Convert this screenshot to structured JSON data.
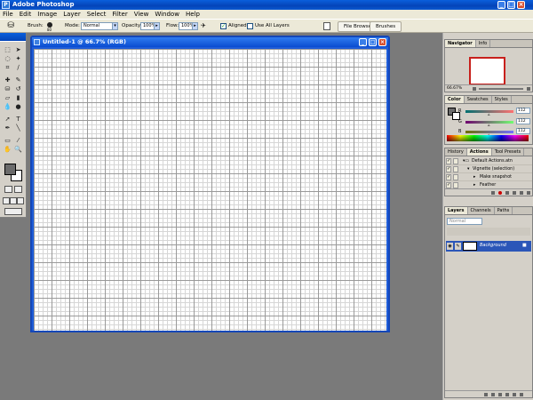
{
  "window": {
    "title": "Adobe Photoshop",
    "buttons": [
      "_",
      "□",
      "×"
    ]
  },
  "menu": [
    "File",
    "Edit",
    "Image",
    "Layer",
    "Select",
    "Filter",
    "View",
    "Window",
    "Help"
  ],
  "options_bar": {
    "brush_label": "Brush:",
    "brush_size": "80",
    "mode_label": "Mode:",
    "mode_value": "Normal",
    "opacity_label": "Opacity:",
    "opacity_value": "100%",
    "flow_label": "Flow:",
    "flow_value": "100%",
    "aligned_label": "Aligned",
    "aligned_checked": true,
    "use_all_layers_label": "Use All Layers",
    "use_all_layers_checked": false,
    "file_browser_label": "File Browser",
    "brushes_label": "Brushes"
  },
  "document": {
    "title": "Untitled-1 @ 66.7% (RGB)",
    "grid_color": "#9a9a9a",
    "subgrid_color": "#d6d6d6"
  },
  "navigator": {
    "tabs": [
      "Navigator",
      "Info"
    ],
    "zoom": "66.67%",
    "view_box_color": "#c8201c"
  },
  "color_panel": {
    "tabs": [
      "Color",
      "Swatches",
      "Styles"
    ],
    "channels": [
      {
        "label": "R",
        "value": "112"
      },
      {
        "label": "G",
        "value": "112"
      },
      {
        "label": "B",
        "value": "112"
      }
    ],
    "foreground_color": "#6b6b6b",
    "background_color": "#ffffff"
  },
  "actions_panel": {
    "tabs": [
      "History",
      "Actions",
      "Tool Presets"
    ],
    "items": [
      "Default Actions.atn",
      "Vignette (selection)",
      "Make snapshot",
      "Feather"
    ]
  },
  "layers_panel": {
    "tabs": [
      "Layers",
      "Channels",
      "Paths"
    ],
    "blend_mode": "Normal",
    "layers": [
      {
        "name": "Background"
      }
    ]
  }
}
